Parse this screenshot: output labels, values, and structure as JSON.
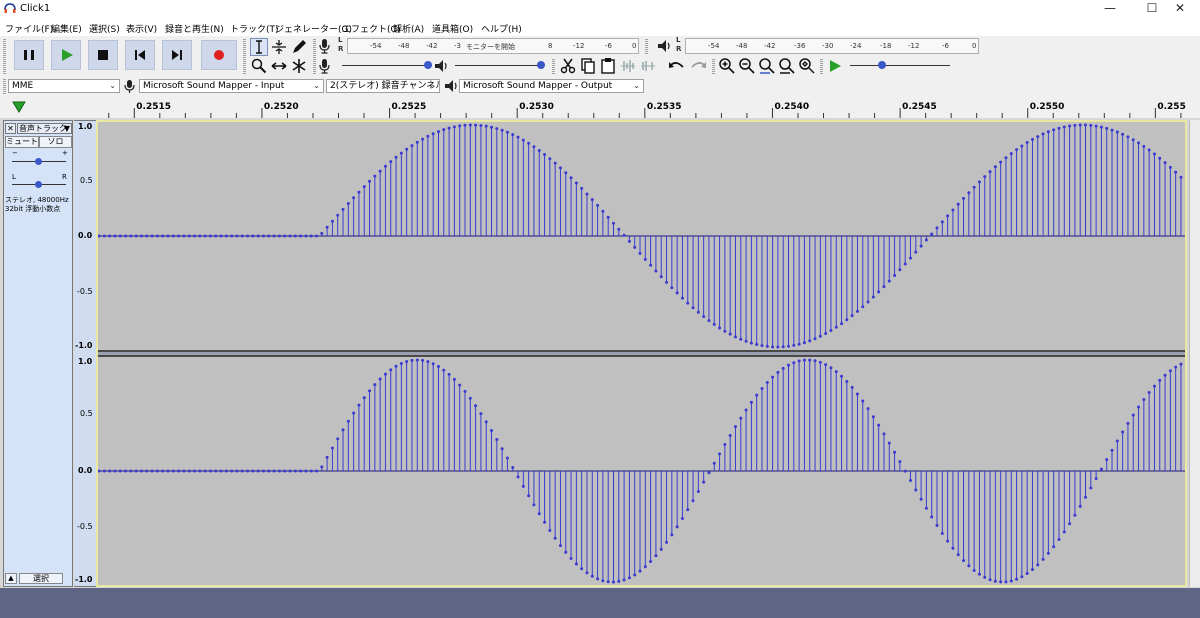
{
  "window": {
    "title": "Click1"
  },
  "window_buttons": {
    "minimize": "—",
    "maximize": "☐",
    "close": "✕"
  },
  "menu": [
    "ファイル(F)",
    "編集(E)",
    "選択(S)",
    "表示(V)",
    "録音と再生(N)",
    "トラック(T)",
    "ジェネレーター(G)",
    "エフェクト(C)",
    "解析(A)",
    "道具箱(O)",
    "ヘルプ(H)"
  ],
  "meters": {
    "record_ticks": [
      "-54",
      "-48",
      "-42",
      "-3",
      "モニターを開始",
      "8",
      "-12",
      "-6",
      "0"
    ],
    "playback_ticks": [
      "-54",
      "-48",
      "-42",
      "-36",
      "-30",
      "-24",
      "-18",
      "-12",
      "-6",
      "0"
    ],
    "L": "L",
    "R": "R"
  },
  "devices": {
    "host": "MME",
    "input": "Microsoft Sound Mapper - Input",
    "channels": "2(ステレオ) 録音チャンネル",
    "output": "Microsoft Sound Mapper - Output"
  },
  "ruler": {
    "labels": [
      "0.2515",
      "0.2520",
      "0.2525",
      "0.2530",
      "0.2535",
      "0.2540",
      "0.2545",
      "0.2550",
      "0.2555"
    ],
    "t_start": 0.25135,
    "t_end": 0.25562
  },
  "track": {
    "name": "音声トラック",
    "mute": "ミュート",
    "solo": "ソロ",
    "gain_minus": "−",
    "gain_plus": "+",
    "pan_left": "L",
    "pan_right": "R",
    "info_line1": "ステレオ, 48000Hz",
    "info_line2": "32bit 浮動小数点",
    "select": "選択",
    "collapse": "▲",
    "close": "✕",
    "menu": "▼",
    "y_labels": [
      "1.0",
      "0.5",
      "0.0",
      "-0.5",
      "-1.0"
    ]
  },
  "chart_data": [
    {
      "type": "line",
      "title": "",
      "channel": "left",
      "sample_rate": 48000,
      "x_range": [
        0.25135,
        0.25562
      ],
      "ylim": [
        -1.0,
        1.0
      ],
      "signal": {
        "onset_time": 0.25222,
        "amplitude": 1.0,
        "frequency_hz": 417,
        "description_points": [
          [
            0.25222,
            0.0
          ],
          [
            0.25282,
            1.0
          ],
          [
            0.25342,
            0.0
          ],
          [
            0.25402,
            -1.0
          ],
          [
            0.25462,
            0.0
          ],
          [
            0.25522,
            1.0
          ]
        ]
      },
      "y_ticks": [
        1.0,
        0.5,
        0.0,
        -0.5,
        -1.0
      ]
    },
    {
      "type": "line",
      "title": "",
      "channel": "right",
      "sample_rate": 48000,
      "x_range": [
        0.25135,
        0.25562
      ],
      "ylim": [
        -1.0,
        1.0
      ],
      "signal": {
        "onset_time": 0.25222,
        "amplitude": 1.0,
        "frequency_hz": 652,
        "description_points": [
          [
            0.25222,
            0.0
          ],
          [
            0.252605,
            1.0
          ],
          [
            0.25299,
            0.0
          ],
          [
            0.253375,
            -1.0
          ],
          [
            0.25376,
            0.0
          ],
          [
            0.254145,
            1.0
          ],
          [
            0.25453,
            0.0
          ],
          [
            0.254915,
            -1.0
          ],
          [
            0.2553,
            0.0
          ],
          [
            0.255685,
            1.0
          ]
        ]
      },
      "y_ticks": [
        1.0,
        0.5,
        0.0,
        -0.5,
        -1.0
      ]
    }
  ],
  "colors": {
    "waveform": "#3a3ad0",
    "wave_bg": "#c0c0c0",
    "track_panel": "#d4e3f7",
    "selection_border": "#e8e8a0",
    "bottom": "#5e6585",
    "record": "#e02020",
    "play": "#22a022"
  }
}
